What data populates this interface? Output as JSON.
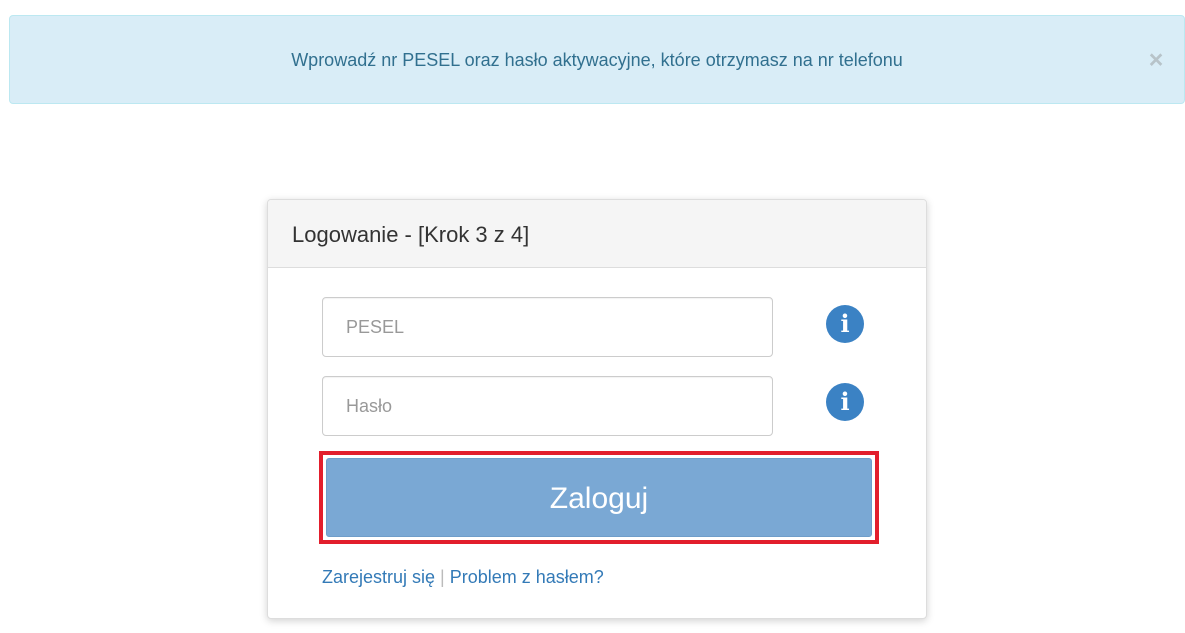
{
  "alert": {
    "message": "Wprowadź nr PESEL oraz hasło aktywacyjne, które otrzymasz na nr telefonu",
    "close_label": "×"
  },
  "login_panel": {
    "title": "Logowanie - [Krok 3 z 4]",
    "fields": {
      "pesel": {
        "placeholder": "PESEL",
        "value": ""
      },
      "password": {
        "placeholder": "Hasło",
        "value": ""
      }
    },
    "info_icon_label": "i",
    "submit_label": "Zaloguj",
    "links": {
      "register": "Zarejestruj się",
      "separator": "|",
      "password_problem": "Problem z hasłem?"
    },
    "highlight_color": "#e21e2c",
    "button_color": "#7aa8d4",
    "info_icon_color": "#3b82c4"
  }
}
